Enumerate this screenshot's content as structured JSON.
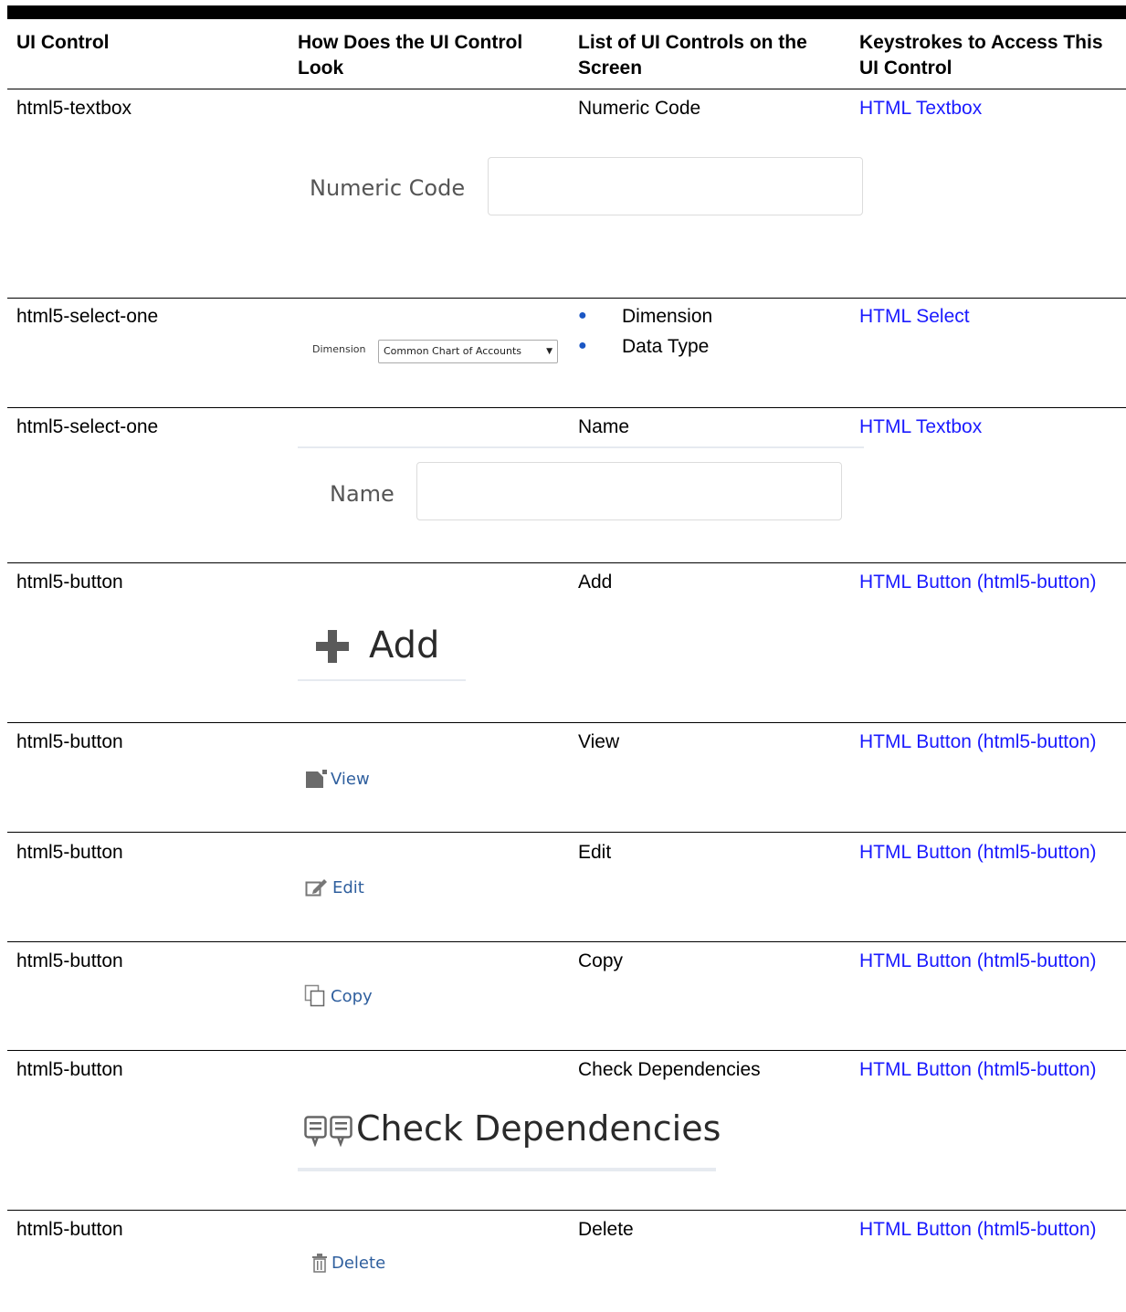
{
  "headers": {
    "col1": "UI Control",
    "col2": "How Does the UI Control Look",
    "col3": "List of UI Controls on the Screen",
    "col4": "Keystrokes to Access This UI Control"
  },
  "rows": [
    {
      "control": "html5-textbox",
      "list": [
        "Numeric Code"
      ],
      "keystroke": "HTML Textbox",
      "illustration": {
        "label": "Numeric Code"
      }
    },
    {
      "control": "html5-select-one",
      "list": [
        "Dimension",
        "Data Type"
      ],
      "keystroke": "HTML Select",
      "illustration": {
        "label": "Dimension",
        "selected": "Common Chart of Accounts"
      }
    },
    {
      "control": "html5-select-one",
      "list": [
        "Name"
      ],
      "keystroke": "HTML Textbox",
      "illustration": {
        "label": "Name"
      }
    },
    {
      "control": "html5-button",
      "list": [
        "Add"
      ],
      "keystroke": "HTML Button (html5-button)",
      "illustration": {
        "label": "Add",
        "icon": "plus-icon"
      }
    },
    {
      "control": "html5-button",
      "list": [
        "View"
      ],
      "keystroke": "HTML Button (html5-button)",
      "illustration": {
        "label": "View",
        "icon": "document-icon"
      }
    },
    {
      "control": "html5-button",
      "list": [
        "Edit"
      ],
      "keystroke": "HTML Button (html5-button)",
      "illustration": {
        "label": "Edit",
        "icon": "edit-icon"
      }
    },
    {
      "control": "html5-button",
      "list": [
        "Copy"
      ],
      "keystroke": "HTML Button (html5-button)",
      "illustration": {
        "label": "Copy",
        "icon": "copy-icon"
      }
    },
    {
      "control": "html5-button",
      "list": [
        "Check Dependencies"
      ],
      "keystroke": "HTML Button (html5-button)",
      "illustration": {
        "label": "Check Dependencies",
        "icon": "dependencies-icon"
      }
    },
    {
      "control": "html5-button",
      "list": [
        "Delete"
      ],
      "keystroke": "HTML Button (html5-button)",
      "illustration": {
        "label": "Delete",
        "icon": "trash-icon"
      }
    }
  ],
  "colors": {
    "link": "#1a1aff",
    "bullet": "#1a56c4",
    "small_button_text": "#2f5f9e"
  }
}
